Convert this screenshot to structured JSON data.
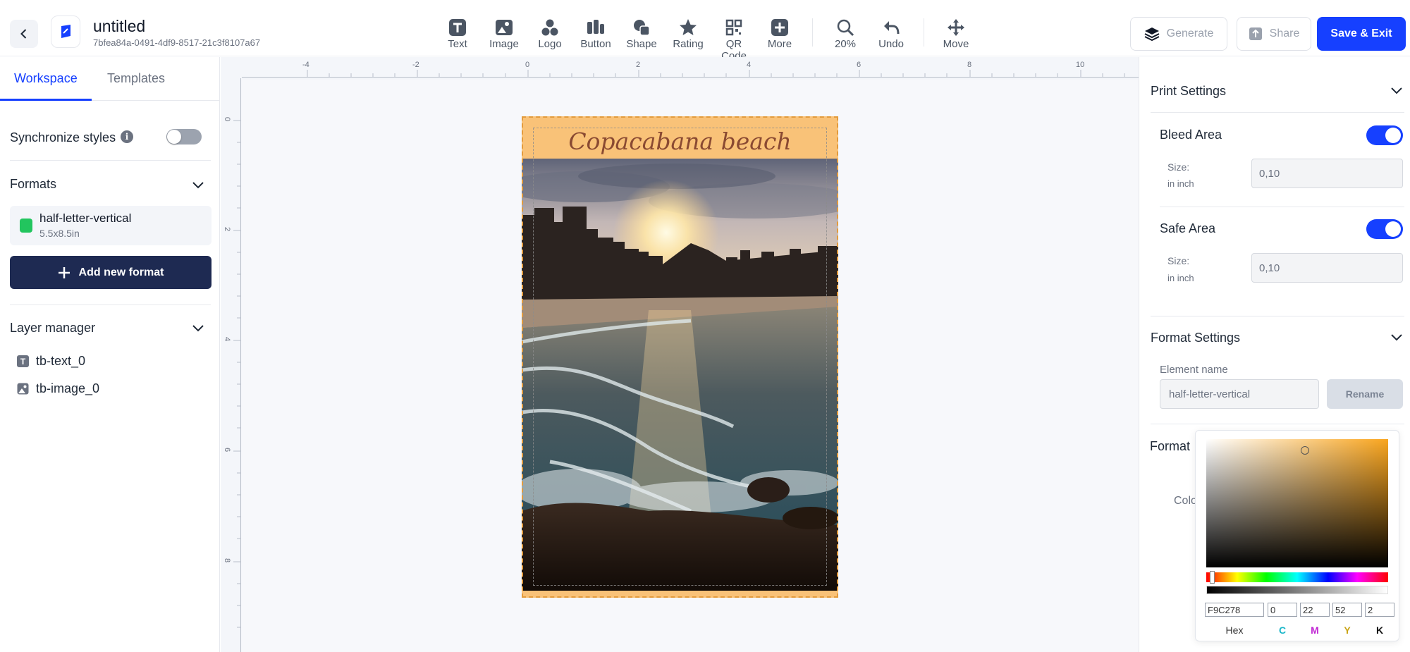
{
  "header": {
    "title": "untitled",
    "doc_id": "7bfea84a-0491-4df9-8517-21c3f8107a67",
    "tools": [
      {
        "label": "Text",
        "icon": "text-icon"
      },
      {
        "label": "Image",
        "icon": "image-icon"
      },
      {
        "label": "Logo",
        "icon": "logo-icon"
      },
      {
        "label": "Button",
        "icon": "button-icon"
      },
      {
        "label": "Shape",
        "icon": "shape-icon"
      },
      {
        "label": "Rating",
        "icon": "star-icon"
      },
      {
        "label": "QR Code",
        "icon": "qr-code-icon"
      },
      {
        "label": "More",
        "icon": "plus-square-icon"
      },
      {
        "label": "20%",
        "icon": "zoom-icon"
      },
      {
        "label": "Undo",
        "icon": "undo-icon"
      },
      {
        "label": "Move",
        "icon": "move-icon"
      }
    ],
    "generate_label": "Generate",
    "share_label": "Share",
    "save_label": "Save & Exit"
  },
  "left_panel": {
    "tabs": [
      "Workspace",
      "Templates"
    ],
    "active_tab": "Workspace",
    "sync_label": "Synchronize styles",
    "sync_on": false,
    "formats_title": "Formats",
    "format": {
      "name": "half-letter-vertical",
      "size": "5.5x8.5in"
    },
    "add_format_label": "Add new format",
    "layer_title": "Layer manager",
    "layers": [
      {
        "name": "tb-text_0",
        "icon": "text-layer-icon"
      },
      {
        "name": "tb-image_0",
        "icon": "image-layer-icon"
      }
    ]
  },
  "canvas": {
    "ruler_top": [
      "-4",
      "-2",
      "0",
      "2",
      "4",
      "6",
      "8",
      "10"
    ],
    "ruler_left": [
      "0",
      "2",
      "4",
      "6",
      "8"
    ],
    "banner_text": "Copacabana beach",
    "background_color": "#F9C278"
  },
  "right_panel": {
    "print_settings_title": "Print Settings",
    "bleed_label": "Bleed Area",
    "bleed_on": true,
    "bleed_size_label": "Size:",
    "bleed_size_unit": "in inch",
    "bleed_size_value": "0,10",
    "safe_label": "Safe Area",
    "safe_on": true,
    "safe_size_label": "Size:",
    "safe_size_unit": "in inch",
    "safe_size_value": "0,10",
    "format_settings_title": "Format Settings",
    "element_name_label": "Element name",
    "element_name_value": "half-letter-vertical",
    "rename_label": "Rename",
    "format_label": "Format",
    "color_label": "Colo"
  },
  "color_picker": {
    "hex": "F9C278",
    "c": "0",
    "m": "22",
    "y": "52",
    "k": "2",
    "labels": {
      "hex": "Hex",
      "c": "C",
      "m": "M",
      "y": "Y",
      "k": "K"
    },
    "label_colors": {
      "c": "#19b6c9",
      "m": "#c026d3",
      "y": "#c9a416",
      "k": "#111111"
    }
  },
  "colors": {
    "accent": "#1640FF",
    "navy_button": "#1E2A52",
    "artboard_bg": "#F9C278"
  }
}
